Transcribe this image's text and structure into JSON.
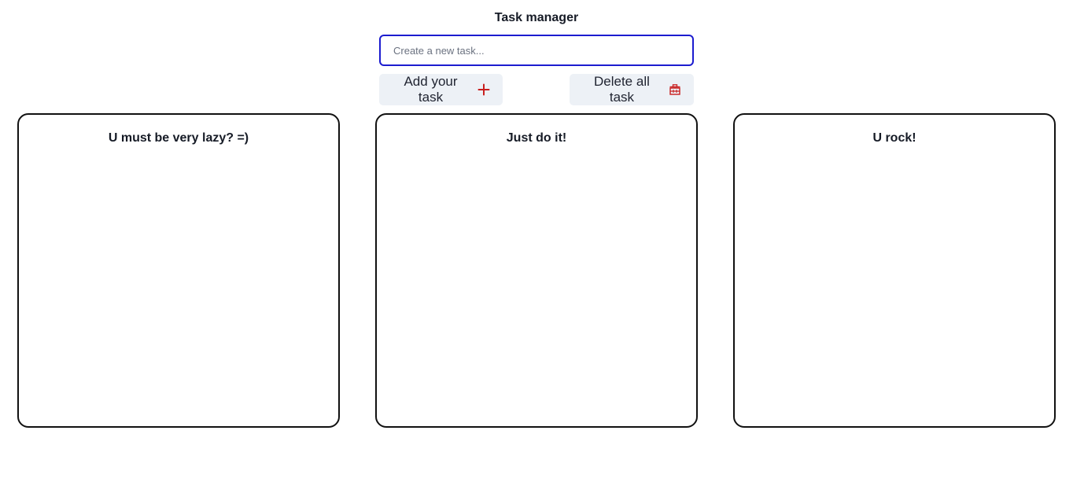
{
  "header": {
    "title": "Task manager"
  },
  "task_input": {
    "placeholder": "Create a new task...",
    "value": ""
  },
  "actions": {
    "add_label": "Add your task",
    "add_icon": "plus-icon",
    "delete_label": "Delete all task",
    "delete_icon": "trash-icon"
  },
  "columns": [
    {
      "title": "U must be very lazy? =)"
    },
    {
      "title": "Just do it!"
    },
    {
      "title": "U rock!"
    }
  ],
  "colors": {
    "input_border": "#1c1ccf",
    "button_bg": "#edf1f6",
    "icon_red": "#c81e1e",
    "column_border": "#111111"
  }
}
